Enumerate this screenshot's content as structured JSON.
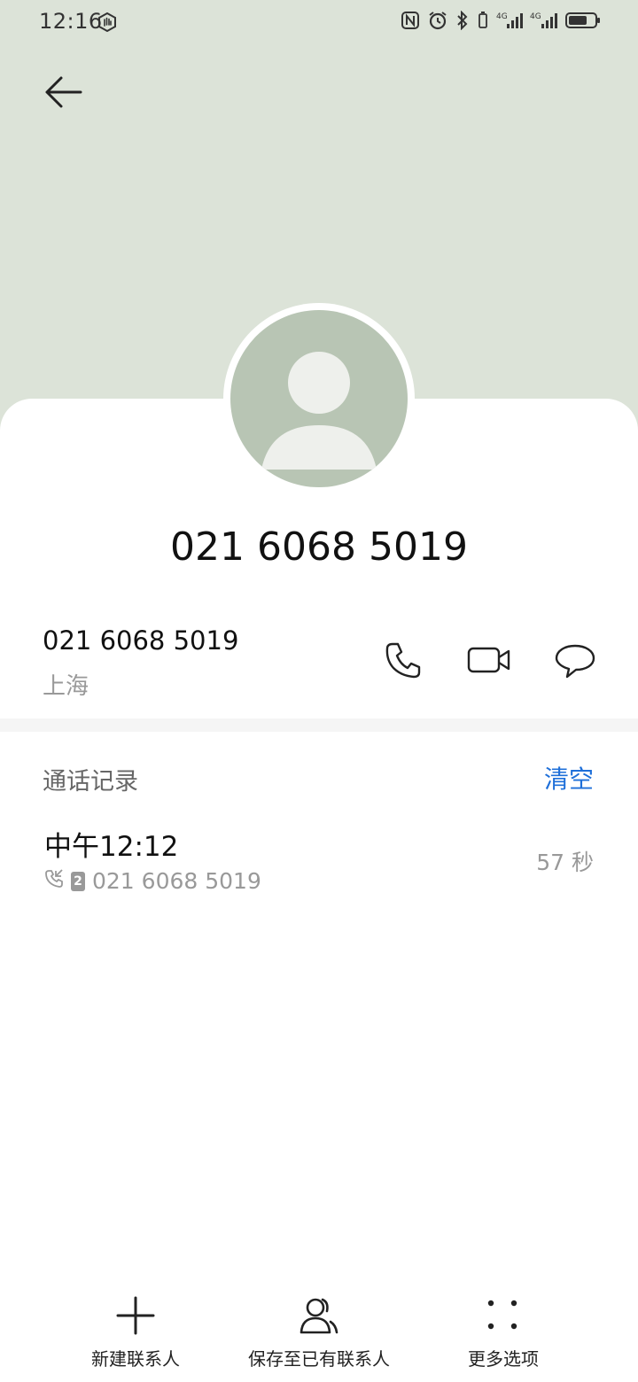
{
  "status_bar": {
    "time": "12:16",
    "icons": [
      "hand-icon",
      "nfc-icon",
      "alarm-icon",
      "bluetooth-icon",
      "vibrate-icon",
      "signal-4g-icon",
      "signal-4g-icon",
      "battery-icon"
    ]
  },
  "header": {
    "back_icon": "arrow-left-icon",
    "background_color": "#dce3d8"
  },
  "contact": {
    "display_number": "021 6068 5019",
    "number": "021 6068 5019",
    "location": "上海"
  },
  "actions": [
    "phone-icon",
    "video-call-icon",
    "message-icon"
  ],
  "call_log": {
    "title": "通话记录",
    "clear_label": "清空",
    "entries": [
      {
        "time": "中午12:12",
        "sim": "2",
        "number": "021 6068 5019",
        "duration": "57 秒"
      }
    ]
  },
  "bottom_bar": {
    "items": [
      {
        "label": "新建联系人",
        "icon": "plus-icon"
      },
      {
        "label": "保存至已有联系人",
        "icon": "contacts-icon"
      },
      {
        "label": "更多选项",
        "icon": "more-dots-icon"
      }
    ]
  },
  "colors": {
    "accent": "#1e6fd9",
    "avatar_bg": "#b8c5b4",
    "avatar_fg": "#eef0ec"
  }
}
